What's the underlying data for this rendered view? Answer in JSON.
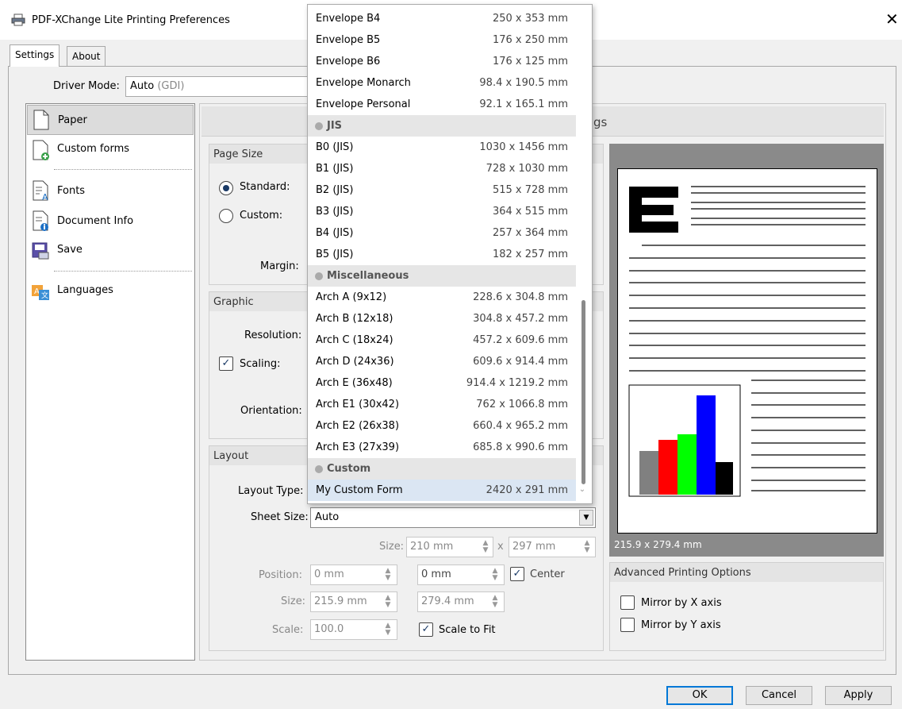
{
  "window": {
    "title": "PDF-XChange Lite Printing Preferences"
  },
  "tabs": [
    {
      "label": "Settings"
    },
    {
      "label": "About"
    }
  ],
  "driver_mode": {
    "label": "Driver Mode:",
    "value": "Auto",
    "sub": "(GDI)"
  },
  "sidebar": {
    "items": [
      {
        "label": "Paper",
        "icon": "page-icon"
      },
      {
        "label": "Custom forms",
        "icon": "custom-form-icon"
      },
      {
        "label": "Fonts",
        "icon": "fonts-icon"
      },
      {
        "label": "Document Info",
        "icon": "document-info-icon"
      },
      {
        "label": "Save",
        "icon": "save-icon"
      },
      {
        "label": "Languages",
        "icon": "languages-icon"
      }
    ]
  },
  "header": {
    "title_fragment": "gs"
  },
  "page_size": {
    "title": "Page Size",
    "standard_label": "Standard:",
    "custom_label": "Custom:",
    "margin_label": "Margin:"
  },
  "graphic": {
    "title": "Graphic",
    "resolution_label": "Resolution:",
    "scaling_label": "Scaling:",
    "orientation_label": "Orientation:"
  },
  "layout": {
    "title": "Layout",
    "layout_type_label": "Layout Type:",
    "sheet_size_label": "Sheet Size:",
    "sheet_size_value": "Auto",
    "size_label": "Size:",
    "size_w": "210 mm",
    "size_x": "x",
    "size_h": "297 mm",
    "position_label": "Position:",
    "pos_x": "0 mm",
    "pos_y": "0 mm",
    "center_label": "Center",
    "size2_label": "Size:",
    "size2_w": "215.9 mm",
    "size2_h": "279.4 mm",
    "scale_label": "Scale:",
    "scale_value": "100.0",
    "scale_to_fit_label": "Scale to Fit"
  },
  "preview": {
    "dims": "215.9 x 279.4 mm"
  },
  "advanced": {
    "title": "Advanced Printing Options",
    "mirror_x": "Mirror by X axis",
    "mirror_y": "Mirror by Y axis"
  },
  "dropdown": {
    "rows": [
      {
        "name": "Envelope B4",
        "dims": "250 x 353 mm"
      },
      {
        "name": "Envelope B5",
        "dims": "176 x 250 mm"
      },
      {
        "name": "Envelope B6",
        "dims": "176 x 125 mm"
      },
      {
        "name": "Envelope Monarch",
        "dims": "98.4 x 190.5 mm"
      },
      {
        "name": "Envelope Personal",
        "dims": "92.1 x 165.1 mm"
      },
      {
        "name": "JIS",
        "header": true
      },
      {
        "name": "B0 (JIS)",
        "dims": "1030 x 1456 mm"
      },
      {
        "name": "B1 (JIS)",
        "dims": "728 x 1030 mm"
      },
      {
        "name": "B2 (JIS)",
        "dims": "515 x 728 mm"
      },
      {
        "name": "B3 (JIS)",
        "dims": "364 x 515 mm"
      },
      {
        "name": "B4 (JIS)",
        "dims": "257 x 364 mm"
      },
      {
        "name": "B5 (JIS)",
        "dims": "182 x 257 mm"
      },
      {
        "name": "Miscellaneous",
        "header": true
      },
      {
        "name": "Arch A (9x12)",
        "dims": "228.6 x 304.8 mm"
      },
      {
        "name": "Arch B (12x18)",
        "dims": "304.8 x 457.2 mm"
      },
      {
        "name": "Arch C (18x24)",
        "dims": "457.2 x 609.6 mm"
      },
      {
        "name": "Arch D (24x36)",
        "dims": "609.6 x 914.4 mm"
      },
      {
        "name": "Arch E (36x48)",
        "dims": "914.4 x 1219.2 mm"
      },
      {
        "name": "Arch E1 (30x42)",
        "dims": "762 x 1066.8 mm"
      },
      {
        "name": "Arch E2 (26x38)",
        "dims": "660.4 x 965.2 mm"
      },
      {
        "name": "Arch E3 (27x39)",
        "dims": "685.8 x 990.6 mm"
      },
      {
        "name": "Custom",
        "header": true
      },
      {
        "name": "My Custom Form",
        "dims": "2420 x 291 mm",
        "selected": true
      }
    ]
  },
  "buttons": {
    "ok": "OK",
    "cancel": "Cancel",
    "apply": "Apply"
  },
  "colors": {
    "accent": "#0078d7",
    "selected_row": "#dbe6f3",
    "preview_bg": "#8a8a8a"
  }
}
